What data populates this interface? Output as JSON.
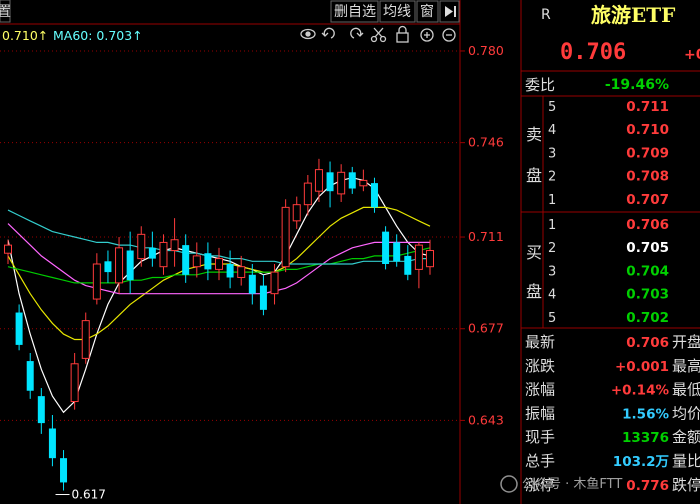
{
  "toolbar": {
    "tabs": [
      {
        "label": "置"
      },
      {
        "label": "删自选"
      },
      {
        "label": "均线"
      },
      {
        "label": "窗"
      }
    ],
    "play_icon": "play-pause-icon"
  },
  "ma_legend": {
    "ma_a": "0.710↑",
    "ma60": "MA60: 0.703↑"
  },
  "chart_tools": [
    "eye-icon",
    "undo-icon",
    "redo-icon",
    "scissors-icon",
    "lock-icon",
    "zoom-in-icon",
    "zoom-out-icon"
  ],
  "price_axis": {
    "ticks": [
      "0.780",
      "0.746",
      "0.711",
      "0.677",
      "0.643"
    ]
  },
  "low_marker": "0.617",
  "quote": {
    "badge": "R",
    "name": "旅游ETF",
    "price": "0.706",
    "price_suffix": "+0",
    "ratio_label": "委比",
    "ratio_value": "-19.46%"
  },
  "sell": {
    "label_top": "卖",
    "label_bottom": "盘",
    "levels": [
      {
        "n": "5",
        "price": "0.711"
      },
      {
        "n": "4",
        "price": "0.710"
      },
      {
        "n": "3",
        "price": "0.709"
      },
      {
        "n": "2",
        "price": "0.708"
      },
      {
        "n": "1",
        "price": "0.707"
      }
    ]
  },
  "buy": {
    "label_top": "买",
    "label_bottom": "盘",
    "levels": [
      {
        "n": "1",
        "price": "0.706"
      },
      {
        "n": "2",
        "price": "0.705"
      },
      {
        "n": "3",
        "price": "0.704"
      },
      {
        "n": "4",
        "price": "0.703"
      },
      {
        "n": "5",
        "price": "0.702"
      }
    ]
  },
  "stats": [
    {
      "label": "最新",
      "value": "0.706",
      "right": "开盘"
    },
    {
      "label": "涨跌",
      "value": "+0.001",
      "right": "最高"
    },
    {
      "label": "涨幅",
      "value": "+0.14%",
      "right": "最低"
    },
    {
      "label": "振幅",
      "value": "1.56%",
      "right": "均价"
    },
    {
      "label": "现手",
      "value": "13376",
      "right": "金额"
    },
    {
      "label": "总手",
      "value": "103.2万",
      "right": "量比"
    },
    {
      "label": "涨停",
      "value": "0.776",
      "right": "跌停"
    }
  ],
  "watermark": "公众号 · 木鱼FTT",
  "colors": {
    "up": "#ff3b3b",
    "down": "#00e5ff",
    "flat": "#ffffff",
    "green": "#00d000",
    "ma_white": "#ffffff",
    "ma_yellow": "#e6e600",
    "ma_magenta": "#ff66ff",
    "ma_green": "#00cc00",
    "ma_cyan": "#33cccc",
    "grid": "#990000"
  },
  "chart_data": {
    "type": "candlestick",
    "ylim": [
      0.612,
      0.79
    ],
    "candles": [
      {
        "o": 0.705,
        "c": 0.708,
        "h": 0.71,
        "l": 0.701
      },
      {
        "o": 0.683,
        "c": 0.671,
        "h": 0.686,
        "l": 0.669
      },
      {
        "o": 0.665,
        "c": 0.654,
        "h": 0.668,
        "l": 0.651
      },
      {
        "o": 0.652,
        "c": 0.642,
        "h": 0.655,
        "l": 0.638
      },
      {
        "o": 0.64,
        "c": 0.629,
        "h": 0.645,
        "l": 0.626
      },
      {
        "o": 0.629,
        "c": 0.62,
        "h": 0.632,
        "l": 0.617
      },
      {
        "o": 0.65,
        "c": 0.664,
        "h": 0.668,
        "l": 0.647
      },
      {
        "o": 0.666,
        "c": 0.68,
        "h": 0.683,
        "l": 0.664
      },
      {
        "o": 0.688,
        "c": 0.701,
        "h": 0.705,
        "l": 0.686
      },
      {
        "o": 0.702,
        "c": 0.698,
        "h": 0.706,
        "l": 0.694
      },
      {
        "o": 0.694,
        "c": 0.707,
        "h": 0.711,
        "l": 0.69
      },
      {
        "o": 0.706,
        "c": 0.695,
        "h": 0.713,
        "l": 0.69
      },
      {
        "o": 0.703,
        "c": 0.712,
        "h": 0.715,
        "l": 0.7
      },
      {
        "o": 0.707,
        "c": 0.703,
        "h": 0.713,
        "l": 0.7
      },
      {
        "o": 0.7,
        "c": 0.709,
        "h": 0.712,
        "l": 0.697
      },
      {
        "o": 0.706,
        "c": 0.71,
        "h": 0.718,
        "l": 0.7
      },
      {
        "o": 0.708,
        "c": 0.697,
        "h": 0.712,
        "l": 0.694
      },
      {
        "o": 0.7,
        "c": 0.704,
        "h": 0.709,
        "l": 0.696
      },
      {
        "o": 0.705,
        "c": 0.699,
        "h": 0.709,
        "l": 0.695
      },
      {
        "o": 0.699,
        "c": 0.703,
        "h": 0.707,
        "l": 0.695
      },
      {
        "o": 0.701,
        "c": 0.696,
        "h": 0.706,
        "l": 0.692
      },
      {
        "o": 0.696,
        "c": 0.7,
        "h": 0.704,
        "l": 0.693
      },
      {
        "o": 0.697,
        "c": 0.69,
        "h": 0.701,
        "l": 0.686
      },
      {
        "o": 0.693,
        "c": 0.684,
        "h": 0.697,
        "l": 0.682
      },
      {
        "o": 0.69,
        "c": 0.698,
        "h": 0.701,
        "l": 0.686
      },
      {
        "o": 0.7,
        "c": 0.722,
        "h": 0.725,
        "l": 0.698
      },
      {
        "o": 0.717,
        "c": 0.723,
        "h": 0.726,
        "l": 0.714
      },
      {
        "o": 0.723,
        "c": 0.731,
        "h": 0.734,
        "l": 0.719
      },
      {
        "o": 0.728,
        "c": 0.736,
        "h": 0.74,
        "l": 0.724
      },
      {
        "o": 0.735,
        "c": 0.728,
        "h": 0.739,
        "l": 0.722
      },
      {
        "o": 0.727,
        "c": 0.735,
        "h": 0.738,
        "l": 0.724
      },
      {
        "o": 0.735,
        "c": 0.729,
        "h": 0.737,
        "l": 0.727
      },
      {
        "o": 0.73,
        "c": 0.732,
        "h": 0.736,
        "l": 0.728
      },
      {
        "o": 0.731,
        "c": 0.722,
        "h": 0.733,
        "l": 0.72
      },
      {
        "o": 0.713,
        "c": 0.701,
        "h": 0.715,
        "l": 0.699
      },
      {
        "o": 0.709,
        "c": 0.702,
        "h": 0.712,
        "l": 0.7
      },
      {
        "o": 0.704,
        "c": 0.697,
        "h": 0.708,
        "l": 0.695
      },
      {
        "o": 0.699,
        "c": 0.708,
        "h": 0.709,
        "l": 0.692
      },
      {
        "o": 0.7,
        "c": 0.706,
        "h": 0.71,
        "l": 0.697
      }
    ],
    "moving_averages": [
      {
        "color": "ma_white",
        "values": [
          0.71,
          0.69,
          0.675,
          0.662,
          0.652,
          0.646,
          0.65,
          0.662,
          0.675,
          0.686,
          0.694,
          0.698,
          0.702,
          0.704,
          0.706,
          0.707,
          0.706,
          0.705,
          0.704,
          0.703,
          0.702,
          0.7,
          0.699,
          0.697,
          0.698,
          0.704,
          0.712,
          0.72,
          0.726,
          0.73,
          0.732,
          0.733,
          0.732,
          0.729,
          0.722,
          0.715,
          0.709,
          0.705,
          0.704
        ]
      },
      {
        "color": "ma_yellow",
        "values": [
          0.704,
          0.697,
          0.69,
          0.684,
          0.679,
          0.675,
          0.673,
          0.673,
          0.675,
          0.678,
          0.682,
          0.686,
          0.689,
          0.692,
          0.695,
          0.697,
          0.699,
          0.7,
          0.701,
          0.701,
          0.701,
          0.7,
          0.699,
          0.698,
          0.698,
          0.7,
          0.703,
          0.707,
          0.711,
          0.715,
          0.718,
          0.72,
          0.722,
          0.722,
          0.722,
          0.721,
          0.719,
          0.717,
          0.715
        ]
      },
      {
        "color": "ma_magenta",
        "values": [
          0.716,
          0.712,
          0.708,
          0.704,
          0.701,
          0.698,
          0.695,
          0.693,
          0.692,
          0.691,
          0.69,
          0.69,
          0.69,
          0.69,
          0.69,
          0.69,
          0.69,
          0.69,
          0.69,
          0.69,
          0.69,
          0.69,
          0.69,
          0.69,
          0.691,
          0.692,
          0.694,
          0.697,
          0.7,
          0.703,
          0.705,
          0.707,
          0.708,
          0.709,
          0.709,
          0.709,
          0.709,
          0.709,
          0.709
        ]
      },
      {
        "color": "ma_green",
        "values": [
          0.7,
          0.699,
          0.698,
          0.697,
          0.696,
          0.695,
          0.694,
          0.694,
          0.694,
          0.694,
          0.694,
          0.695,
          0.695,
          0.696,
          0.696,
          0.697,
          0.697,
          0.697,
          0.698,
          0.698,
          0.698,
          0.698,
          0.698,
          0.698,
          0.698,
          0.699,
          0.699,
          0.7,
          0.701,
          0.701,
          0.702,
          0.703,
          0.703,
          0.704,
          0.704,
          0.704,
          0.705,
          0.706,
          0.707
        ]
      },
      {
        "color": "ma_cyan",
        "values": [
          0.721,
          0.719,
          0.717,
          0.715,
          0.713,
          0.712,
          0.711,
          0.71,
          0.709,
          0.709,
          0.708,
          0.708,
          0.707,
          0.707,
          0.706,
          0.706,
          0.705,
          0.705,
          0.704,
          0.704,
          0.703,
          0.703,
          0.702,
          0.702,
          0.702,
          0.701,
          0.701,
          0.701,
          0.701,
          0.701,
          0.701,
          0.701,
          0.702,
          0.702,
          0.702,
          0.702,
          0.702,
          0.703,
          0.703
        ]
      }
    ]
  }
}
